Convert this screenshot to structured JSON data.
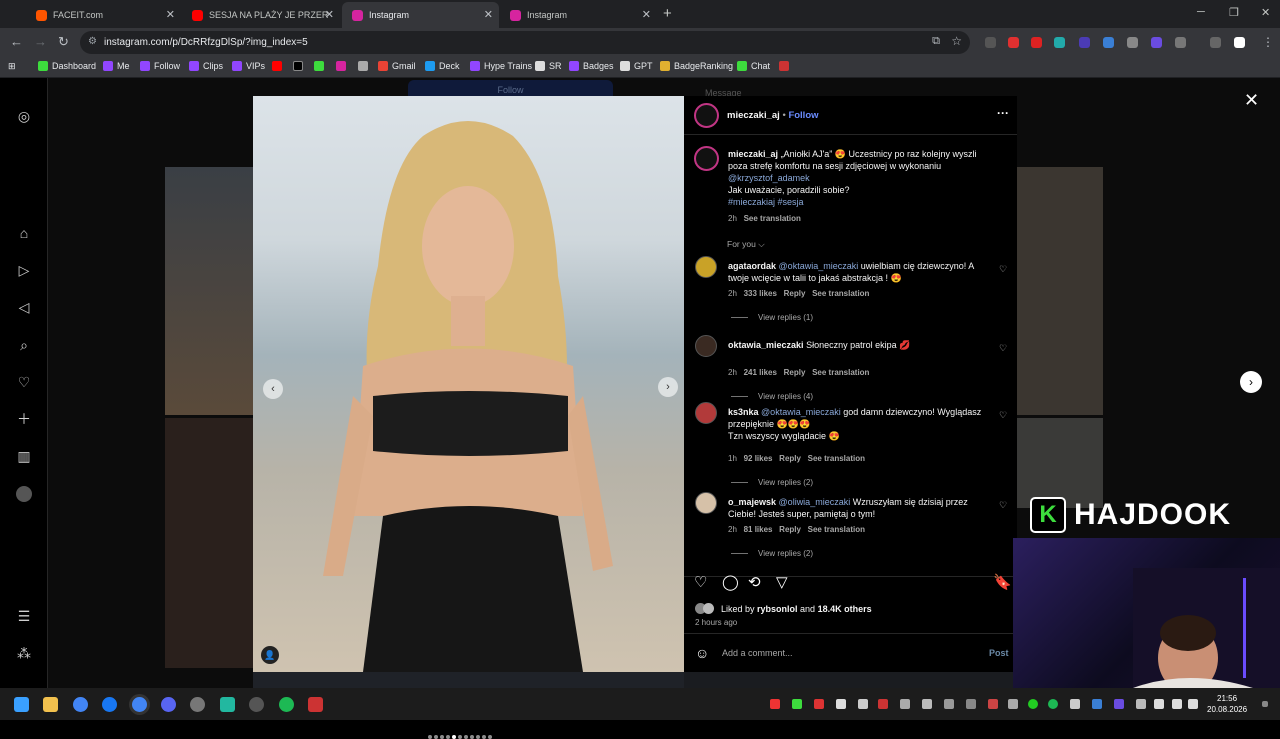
{
  "tabs": [
    {
      "title": "FACEIT.com",
      "color": "#ff5500",
      "active": false
    },
    {
      "title": "SESJA NA PLAŻY JE PRZEROSŁA",
      "color": "#ff0000",
      "active": false
    },
    {
      "title": "Instagram",
      "color": "#d6249f",
      "active": true
    },
    {
      "title": "Instagram",
      "color": "#d6249f",
      "active": false
    }
  ],
  "url": "instagram.com/p/DcRRfzgDlSp/?img_index=5",
  "bookmarks": [
    "Dashboard",
    "Me",
    "Follow",
    "Clips",
    "VIPs",
    "",
    "",
    "",
    "",
    "",
    "Gmail",
    "Deck",
    "Hype Trains",
    "SR",
    "Badges",
    "GPT",
    "BadgeRanking",
    "Chat"
  ],
  "page_behind": {
    "follow": "Follow",
    "message": "Message"
  },
  "post": {
    "username": "mieczaki_aj",
    "follow_label": "Follow",
    "separator": "•",
    "more": "···",
    "caption_user": "mieczaki_aj",
    "caption_text": "„Aniołki AJ'a” 😍 Uczestnicy po raz kolejny wyszli poza strefę komfortu na sesji zdjęciowej w wykonaniu",
    "caption_mention": "@krzysztof_adamek",
    "caption_line2": "Jak uważacie, poradzili sobie?",
    "caption_tags": "#mieczakiaj #sesja",
    "caption_time": "2h",
    "see_translation": "See translation",
    "for_you": "For you",
    "comments": [
      {
        "user": "agataordak",
        "mention": "@oktawia_mieczaki",
        "text": " uwielbiam cię dziewczyno! A twoje wcięcie w talii to jakaś abstrakcja ! 😍",
        "time": "2h",
        "likes": "333 likes",
        "reply": "Reply",
        "translate": "See translation",
        "replies": "View replies (1)",
        "avatar": "#c9a227"
      },
      {
        "user": "oktawia_mieczaki",
        "mention": "",
        "text": " Słoneczny patrol ekipa 💋",
        "time": "2h",
        "likes": "241 likes",
        "reply": "Reply",
        "translate": "See translation",
        "replies": "View replies (4)",
        "avatar": "#3a2a22"
      },
      {
        "user": "ks3nka",
        "mention": "@oktawia_mieczaki",
        "text": " god damn dziewczyno! Wyglądasz przepięknie 😍😍😍",
        "text2": "Tzn wszyscy wyglądacie 😍",
        "time": "1h",
        "likes": "92 likes",
        "reply": "Reply",
        "translate": "See translation",
        "replies": "View replies (2)",
        "avatar": "#b23a3a"
      },
      {
        "user": "o_majewsk",
        "mention": "@oliwia_mieczaki",
        "text": " Wzruszyłam się dzisiaj przez Ciebie! Jesteś super, pamiętaj o tym!",
        "time": "2h",
        "likes": "81 likes",
        "reply": "Reply",
        "translate": "See translation",
        "replies": "View replies (2)",
        "avatar": "#d6c1a8"
      }
    ],
    "liked_by_prefix": "Liked by ",
    "liked_by_user": "rybsonlol",
    "liked_by_mid": " and ",
    "liked_by_others": "18.4K others",
    "posted": "2 hours ago",
    "comment_placeholder": "Add a comment...",
    "post_label": "Post",
    "slides": 11,
    "current_slide": 5
  },
  "overlay": {
    "brand": "HAJDOOK",
    "brand_letter": "K"
  },
  "clock": {
    "time": "21:56",
    "date": "20.08.2026"
  },
  "colors": {
    "accent": "#0095f6",
    "panel": "#000000",
    "ig_mention": "#8aa8d8"
  }
}
